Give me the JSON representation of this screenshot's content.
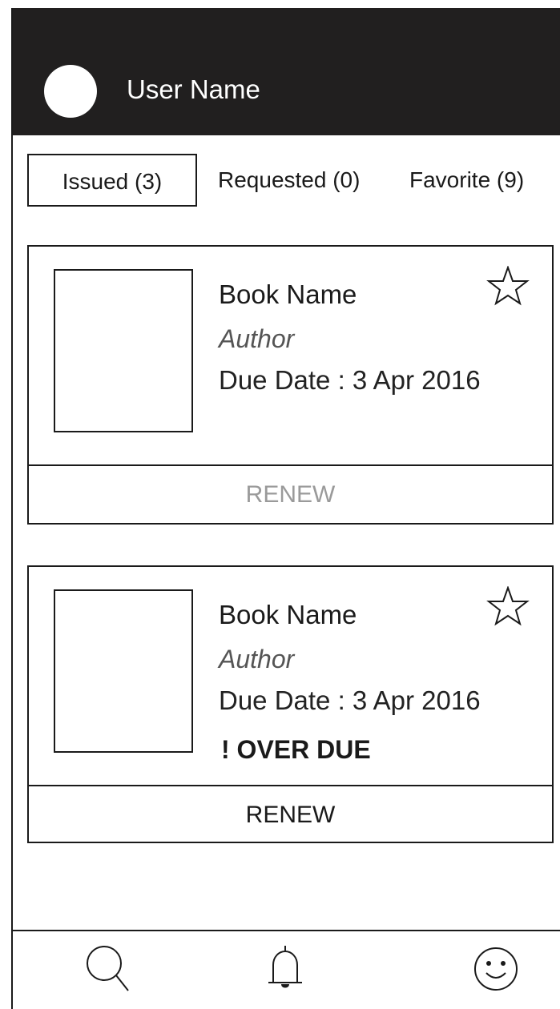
{
  "header": {
    "username": "User Name"
  },
  "tabs": [
    {
      "label": "Issued (3)",
      "active": true
    },
    {
      "label": "Requested (0)",
      "active": false
    },
    {
      "label": "Favorite (9)",
      "active": false
    }
  ],
  "books": [
    {
      "name": "Book Name",
      "author": "Author",
      "due": "Due Date : 3 Apr 2016",
      "overdue": "",
      "renew_label": "RENEW",
      "renew_enabled": false
    },
    {
      "name": "Book Name",
      "author": "Author",
      "due": "Due Date : 3 Apr 2016",
      "overdue": "! OVER DUE",
      "renew_label": "RENEW",
      "renew_enabled": true
    }
  ],
  "bottom_nav": {
    "icons": [
      "search-icon",
      "bell-icon",
      "smiley-icon"
    ]
  },
  "colors": {
    "header_bg": "#211f1f",
    "disabled_text": "#9a9a9a",
    "text": "#1a1a1a"
  }
}
